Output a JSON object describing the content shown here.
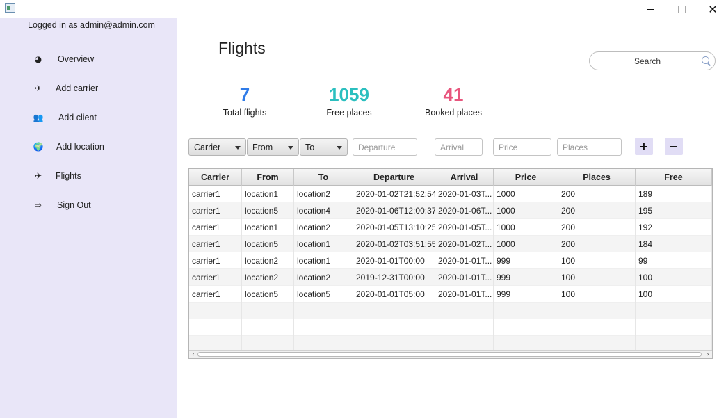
{
  "window": {
    "close_glyph": "✕"
  },
  "sidebar": {
    "logged_in": "Logged in as admin@admin.com",
    "items": [
      {
        "label": "Overview",
        "icon": "dashboard-icon",
        "glyph": "◕"
      },
      {
        "label": "Add carrier",
        "icon": "plane-icon",
        "glyph": "✈"
      },
      {
        "label": "Add client",
        "icon": "users-icon",
        "glyph": "👥"
      },
      {
        "label": "Add location",
        "icon": "globe-icon",
        "glyph": "🌍"
      },
      {
        "label": "Flights",
        "icon": "plane-icon",
        "glyph": "✈"
      },
      {
        "label": "Sign Out",
        "icon": "sign-out-icon",
        "glyph": "⇨"
      }
    ]
  },
  "main": {
    "title": "Flights",
    "search": {
      "placeholder": "Search"
    },
    "stats": [
      {
        "value": "7",
        "label": "Total flights",
        "color": "#2f7be8"
      },
      {
        "value": "1059",
        "label": "Free places",
        "color": "#2bbfbf"
      },
      {
        "value": "41",
        "label": "Booked places",
        "color": "#e8557d"
      }
    ],
    "filters": {
      "carrier": "Carrier",
      "from": "From",
      "to": "To",
      "departure_placeholder": "Departure",
      "arrival_placeholder": "Arrival",
      "price_placeholder": "Price",
      "places_placeholder": "Places",
      "add": "+",
      "remove": "−"
    },
    "table": {
      "columns": [
        "Carrier",
        "From",
        "To",
        "Departure",
        "Arrival",
        "Price",
        "Places",
        "Free"
      ],
      "rows": [
        [
          "carrier1",
          "location1",
          "location2",
          "2020-01-02T21:52:54",
          "2020-01-03T...",
          "1000",
          "200",
          "189"
        ],
        [
          "carrier1",
          "location5",
          "location4",
          "2020-01-06T12:00:37",
          "2020-01-06T...",
          "1000",
          "200",
          "195"
        ],
        [
          "carrier1",
          "location1",
          "location2",
          "2020-01-05T13:10:25",
          "2020-01-05T...",
          "1000",
          "200",
          "192"
        ],
        [
          "carrier1",
          "location5",
          "location1",
          "2020-01-02T03:51:55",
          "2020-01-02T...",
          "1000",
          "200",
          "184"
        ],
        [
          "carrier1",
          "location2",
          "location1",
          "2020-01-01T00:00",
          "2020-01-01T...",
          "999",
          "100",
          "99"
        ],
        [
          "carrier1",
          "location2",
          "location2",
          "2019-12-31T00:00",
          "2020-01-01T...",
          "999",
          "100",
          "100"
        ],
        [
          "carrier1",
          "location5",
          "location5",
          "2020-01-01T05:00",
          "2020-01-01T...",
          "999",
          "100",
          "100"
        ]
      ],
      "empty_rows": 3
    }
  }
}
